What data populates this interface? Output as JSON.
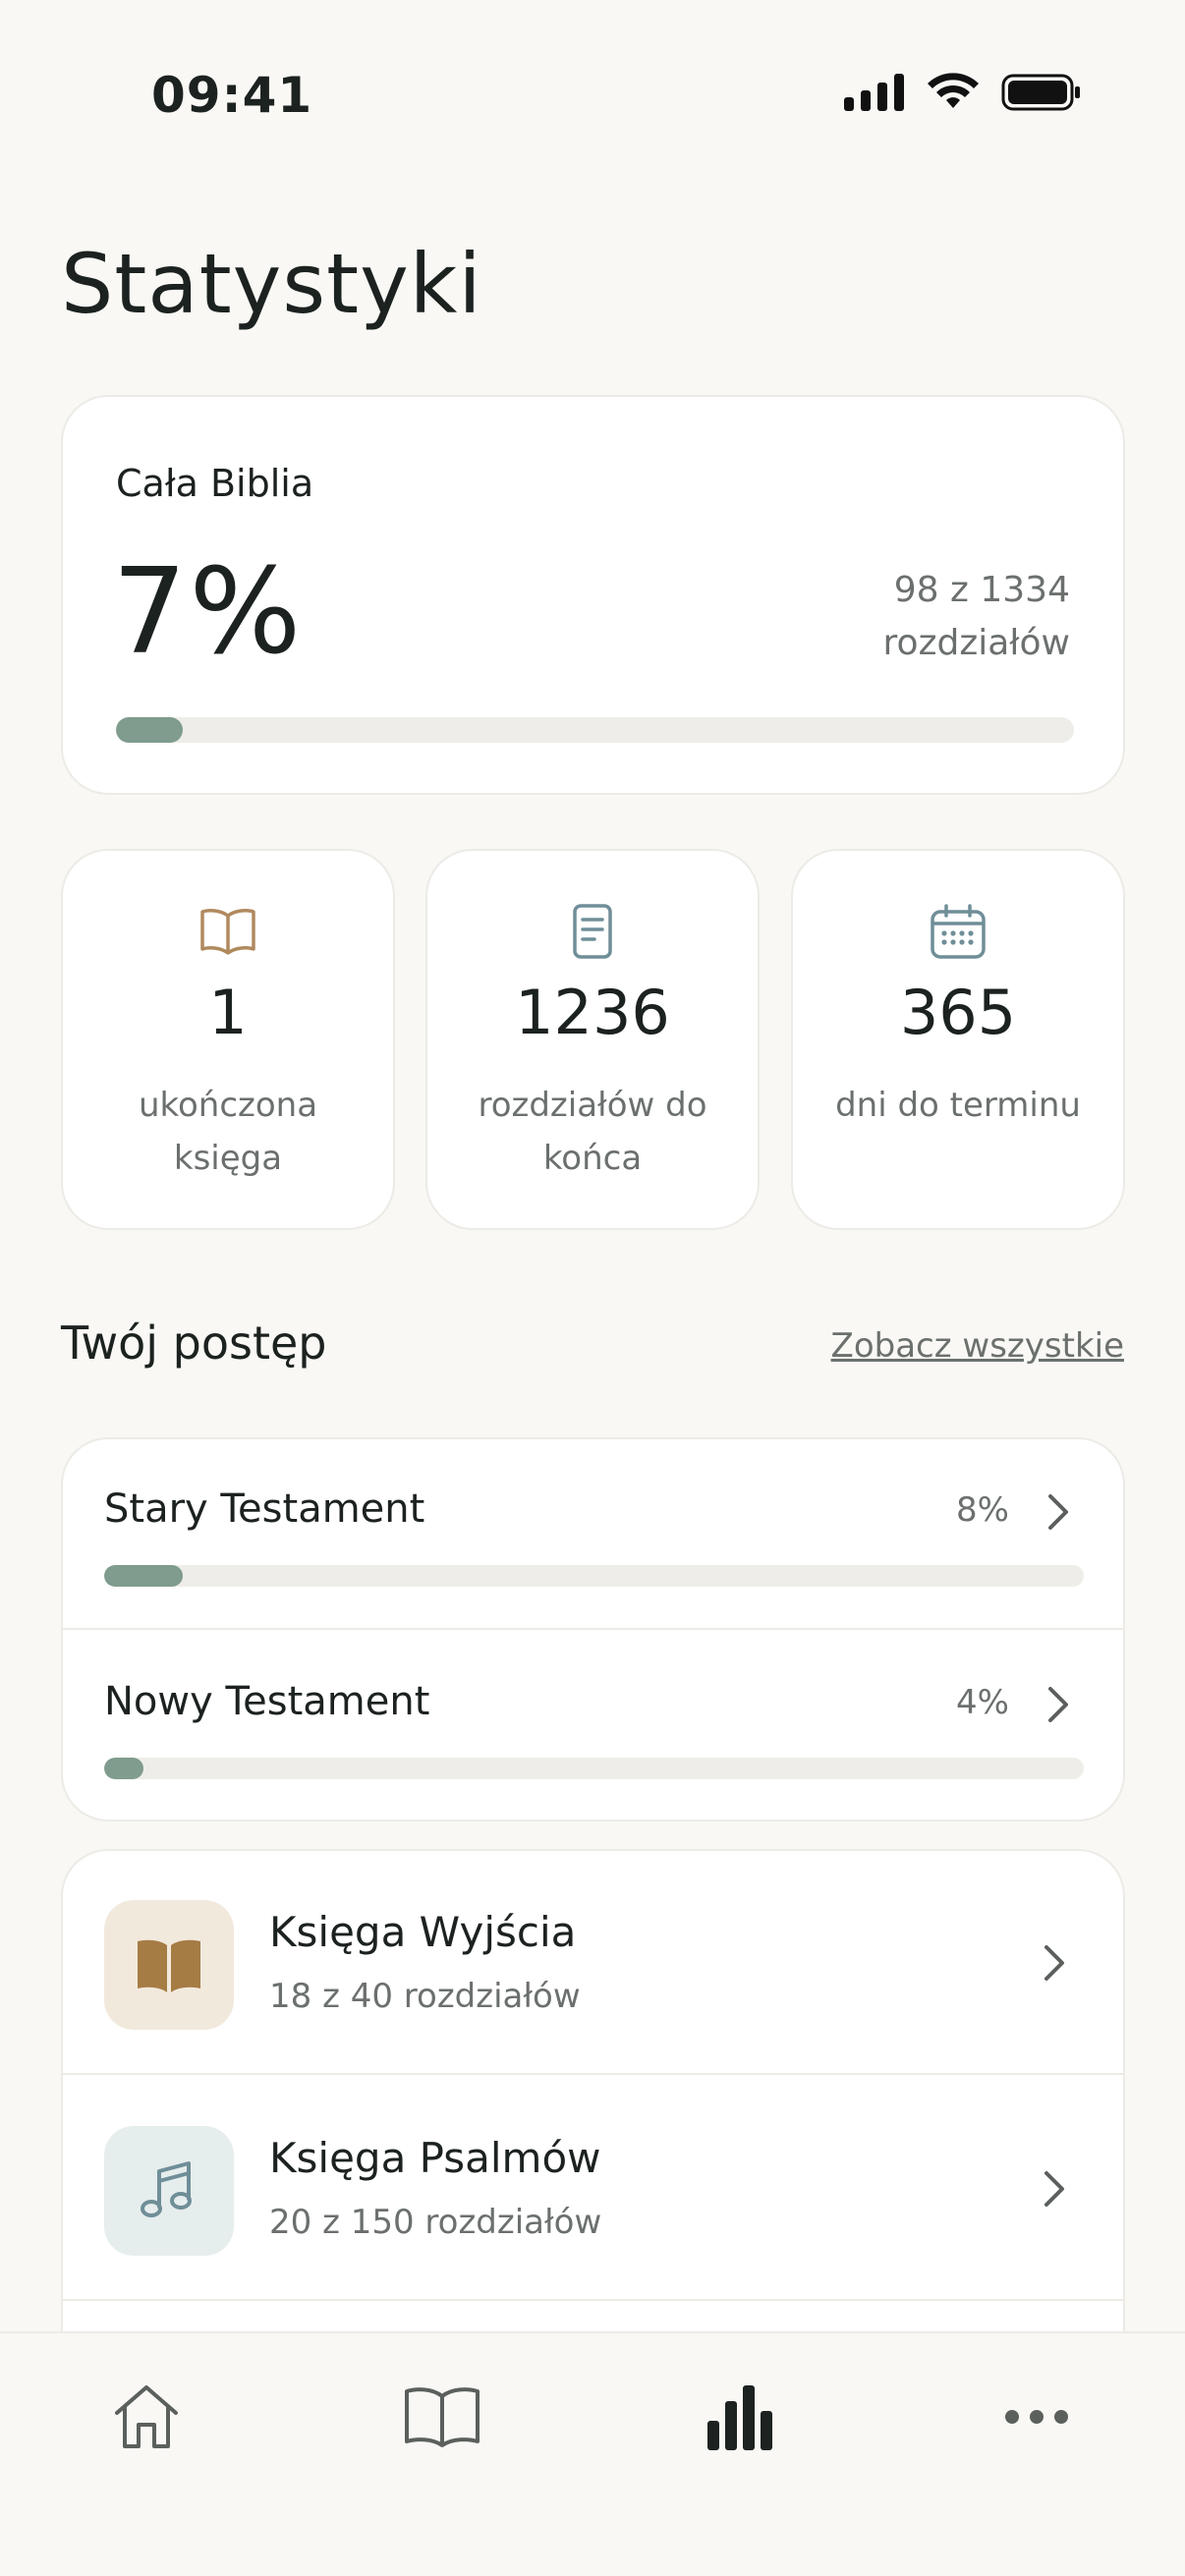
{
  "status_bar": {
    "time": "09:41"
  },
  "page": {
    "title": "Statystyki"
  },
  "overall": {
    "label": "Cała Biblia",
    "percent_text": "7%",
    "progress_fraction": 0.07,
    "count_line1": "98 z 1334",
    "count_line2": "rozdziałów"
  },
  "stats": [
    {
      "value": "1",
      "caption": "ukończona księga",
      "icon": "open-book-icon",
      "color": "#b08a5e"
    },
    {
      "value": "1236",
      "caption": "rozdziałów do końca",
      "icon": "document-icon",
      "color": "#6f8e98"
    },
    {
      "value": "365",
      "caption": "dni do terminu",
      "icon": "calendar-icon",
      "color": "#6f8e98"
    }
  ],
  "progress_section": {
    "title": "Twój postęp",
    "see_all": "Zobacz wszystkie",
    "testaments": [
      {
        "name": "Stary Testament",
        "percent_text": "8%",
        "progress_fraction": 0.08
      },
      {
        "name": "Nowy Testament",
        "percent_text": "4%",
        "progress_fraction": 0.04
      }
    ],
    "books": [
      {
        "name": "Księga Wyjścia",
        "progress": "18 z 40 rozdziałów",
        "icon": "book-icon"
      },
      {
        "name": "Księga Psalmów",
        "progress": "20 z 150 rozdziałów",
        "icon": "music-note-icon"
      }
    ]
  },
  "tab_bar": {
    "items": [
      {
        "icon": "home-icon",
        "active": false
      },
      {
        "icon": "open-book-icon",
        "active": false
      },
      {
        "icon": "bar-chart-icon",
        "active": true
      },
      {
        "icon": "more-icon",
        "active": false
      }
    ]
  },
  "colors": {
    "background": "#f9f8f5",
    "progress_fill": "#7f9c8e",
    "progress_track": "#eeede9",
    "accent_brown": "#a67c45",
    "accent_teal": "#6f8e98"
  }
}
